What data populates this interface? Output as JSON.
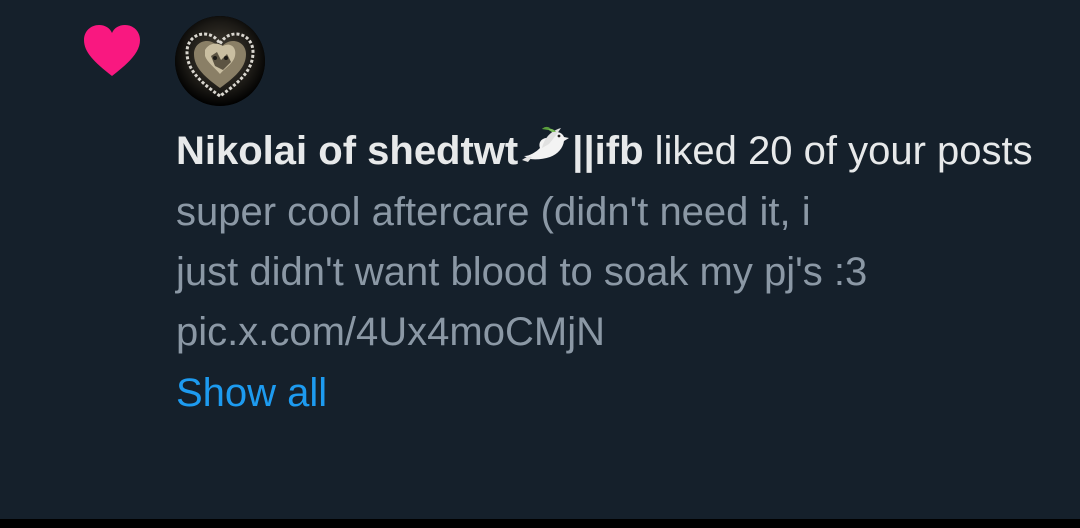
{
  "notification": {
    "icon": "heart-icon",
    "icon_color": "#f91880",
    "avatar": "user-avatar",
    "user_name": "Nikolai of shedtwt",
    "name_emoji": "dove-icon",
    "name_suffix": "||ifb",
    "action_text": " liked 20 of your posts",
    "post_preview_lines": [
      "super cool aftercare (didn't need it, i",
      "just didn't want blood to soak my pj's :3",
      "pic.x.com/4Ux4moCMjN"
    ],
    "show_all_label": "Show all",
    "link_color": "#1d9bf0",
    "background_color": "#15202b",
    "text_color": "#e7e9ea",
    "muted_text_color": "#8b98a5"
  }
}
